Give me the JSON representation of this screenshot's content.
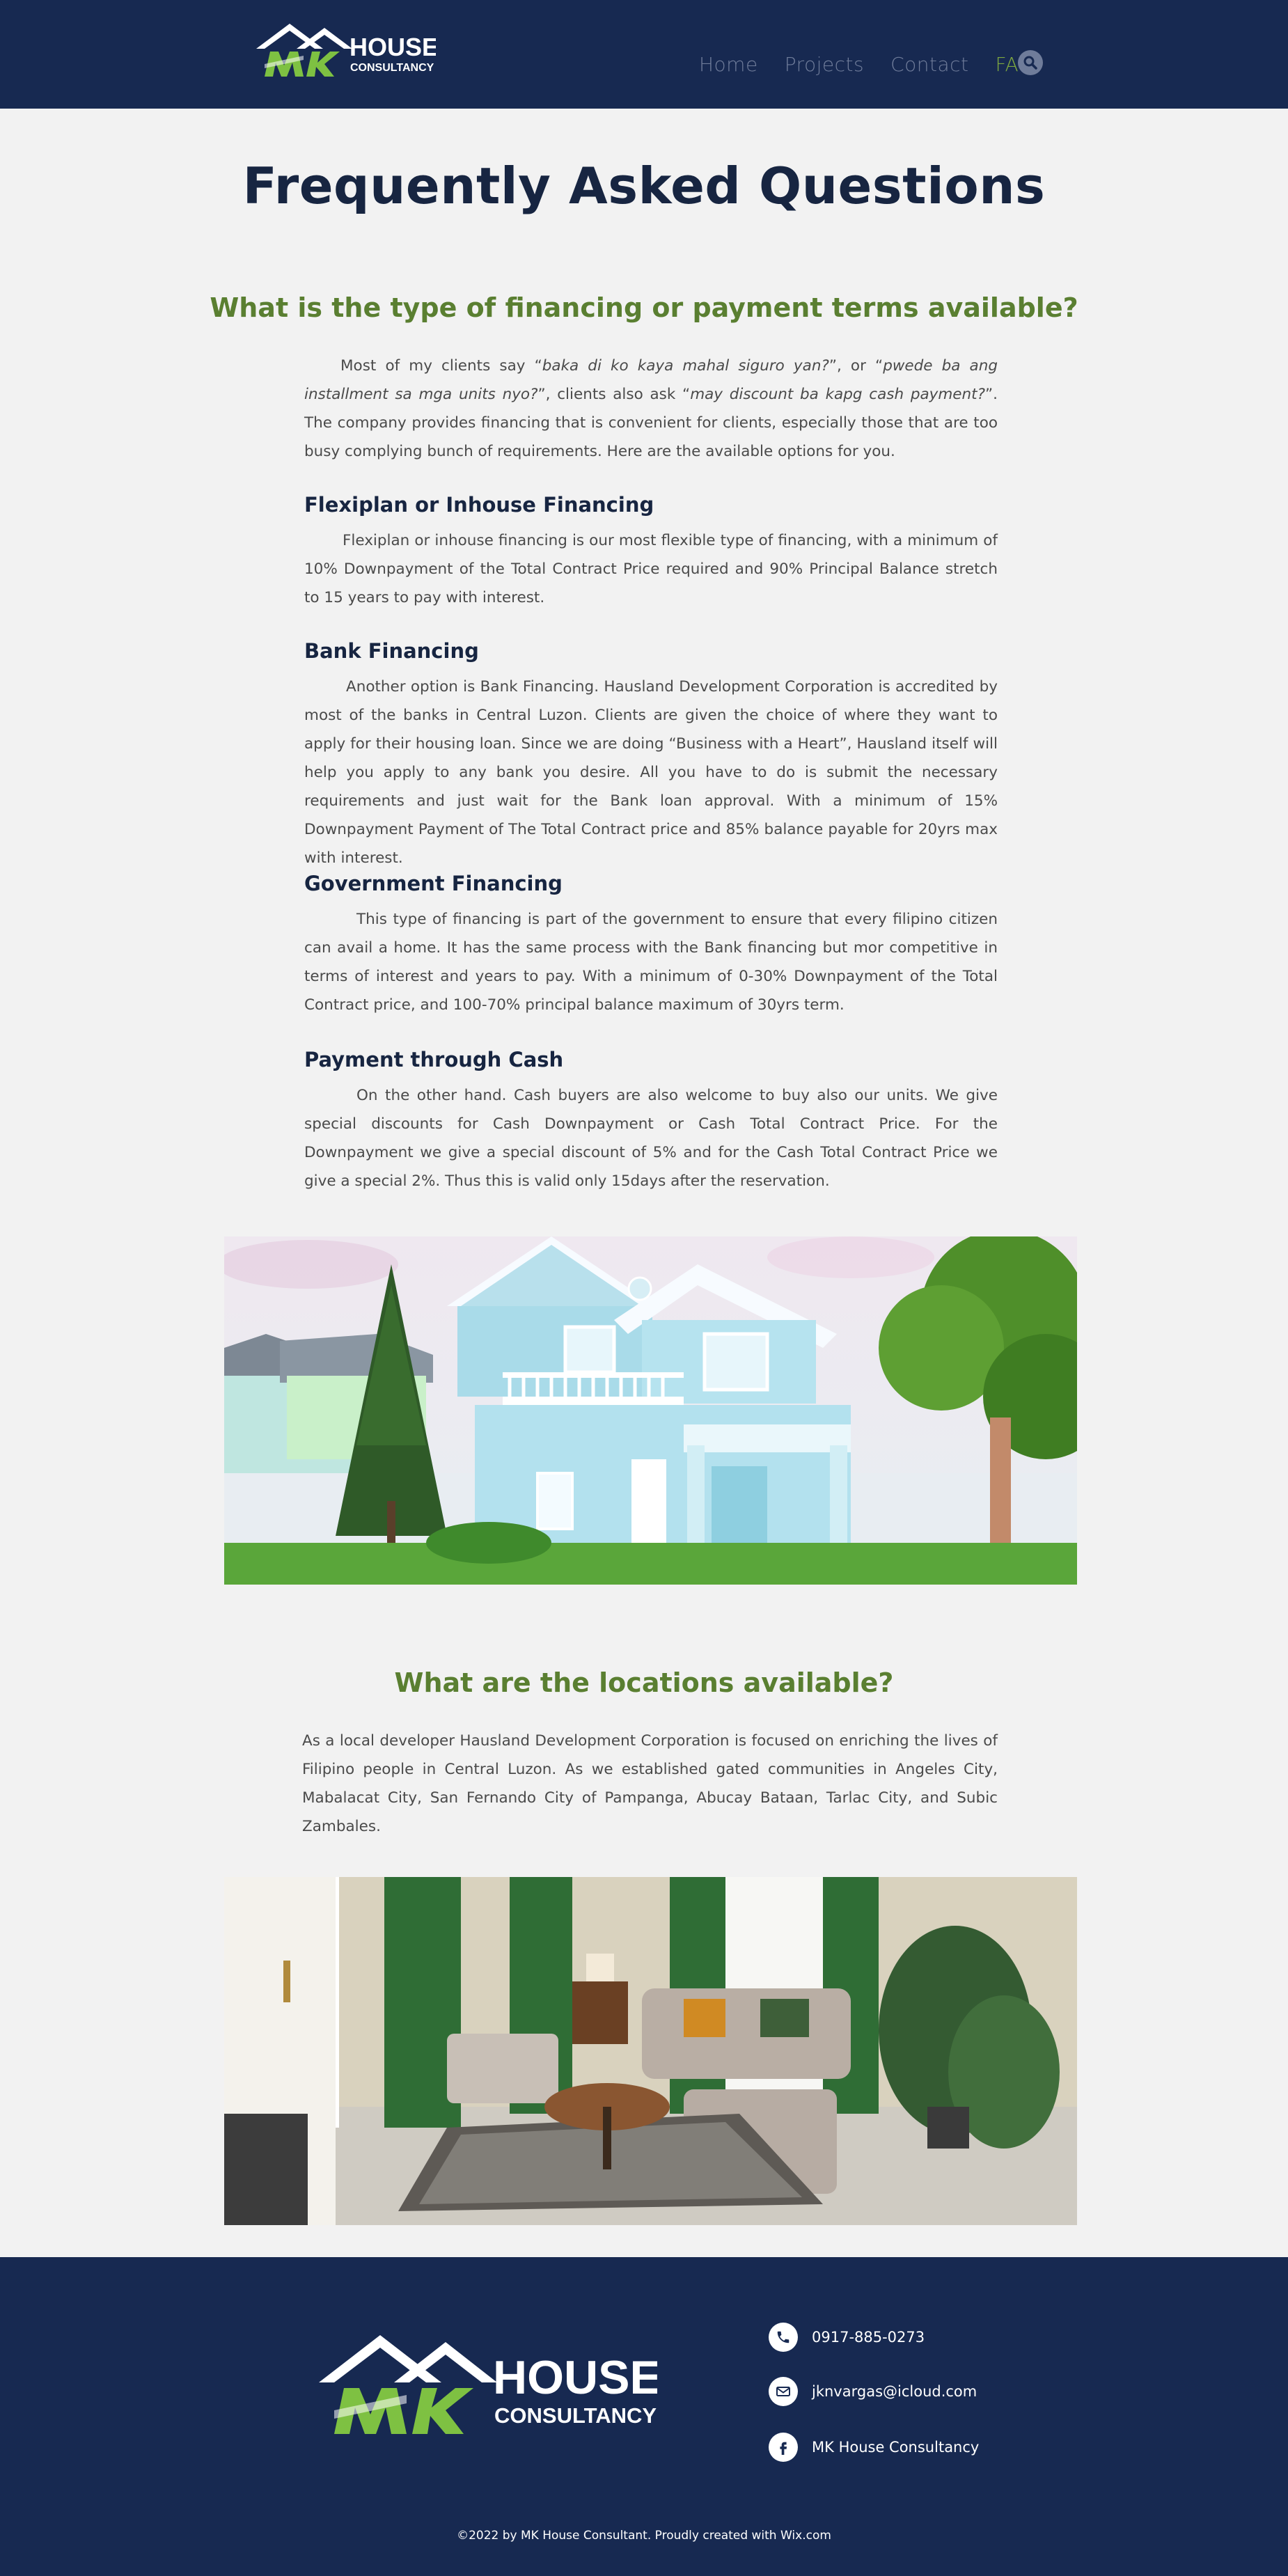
{
  "brand": {
    "name_main": "HOUSE",
    "name_sub": "CONSULTANCY",
    "navy": "#172951",
    "green": "#7ea840",
    "heading_green": "#5a7f31"
  },
  "nav": {
    "items": [
      {
        "label": "Home",
        "active": false
      },
      {
        "label": "Projects",
        "active": false
      },
      {
        "label": "Contact",
        "active": false
      },
      {
        "label": "FAQ",
        "active": true
      }
    ],
    "search_icon": "search-icon"
  },
  "page": {
    "title": "Frequently Asked Questions"
  },
  "financing": {
    "heading": "What is the type of financing or payment terms available?",
    "intro_a": "Most of my clients say “",
    "intro_q1": "baka di ko kaya mahal siguro yan?",
    "intro_b": "”, or “",
    "intro_q2": "pwede ba ang installment sa mga units nyo?",
    "intro_c": "”, clients also ask “",
    "intro_q3": "may discount ba kapg cash payment?",
    "intro_d": "”. The company provides financing that is convenient for clients, especially those that are too busy complying bunch of requirements. Here are the available options for you.",
    "options": [
      {
        "title": "Flexiplan or Inhouse Financing",
        "body": "Flexiplan or inhouse financing is our most flexible type of financing, with a minimum of 10% Downpayment of the Total Contract Price required and 90% Principal Balance stretch to 15 years to pay with interest."
      },
      {
        "title": "Bank Financing",
        "body": "Another option is Bank Financing. Hausland Development Corporation is accredited by most of the banks in Central Luzon. Clients are given the choice of where they want to apply for their housing loan. Since we are doing “Business with a Heart”, Hausland itself will help you apply to any bank you desire. All you have to do is submit the necessary requirements and just wait for the Bank loan approval. With a minimum of 15% Downpayment Payment of The Total Contract price and 85% balance payable for 20yrs max with interest."
      },
      {
        "title": "Government Financing",
        "body": "This type of financing is part of the government to ensure that every filipino citizen can avail a home. It has the same process with the Bank financing but mor competitive in terms of interest and years to pay. With a minimum of 0-30% Downpayment of the Total Contract price, and 100-70% principal balance maximum of 30yrs term."
      },
      {
        "title": "Payment through Cash",
        "body": "On the other hand. Cash buyers are also welcome to buy also our units. We give special discounts for Cash Downpayment or Cash Total Contract Price. For the Downpayment we give a special discount of 5% and for the Cash Total Contract Price we give a special 2%. Thus this is valid only 15days after the reservation."
      }
    ]
  },
  "locations": {
    "heading": "What are the locations available?",
    "body": "As a local developer Hausland Development Corporation is focused on enriching the lives of Filipino people in Central Luzon. As we established gated communities in Angeles City, Mabalacat City, San Fernando City of Pampanga, Abucay Bataan, Tarlac City, and Subic Zambales."
  },
  "footer": {
    "phone": "0917-885-0273",
    "email": "jknvargas@icloud.com",
    "facebook": "MK House Consultancy",
    "copyright": "©2022 by MK House Consultant. Proudly created with Wix.com",
    "icons": [
      "phone-icon",
      "mail-icon",
      "facebook-icon"
    ]
  }
}
